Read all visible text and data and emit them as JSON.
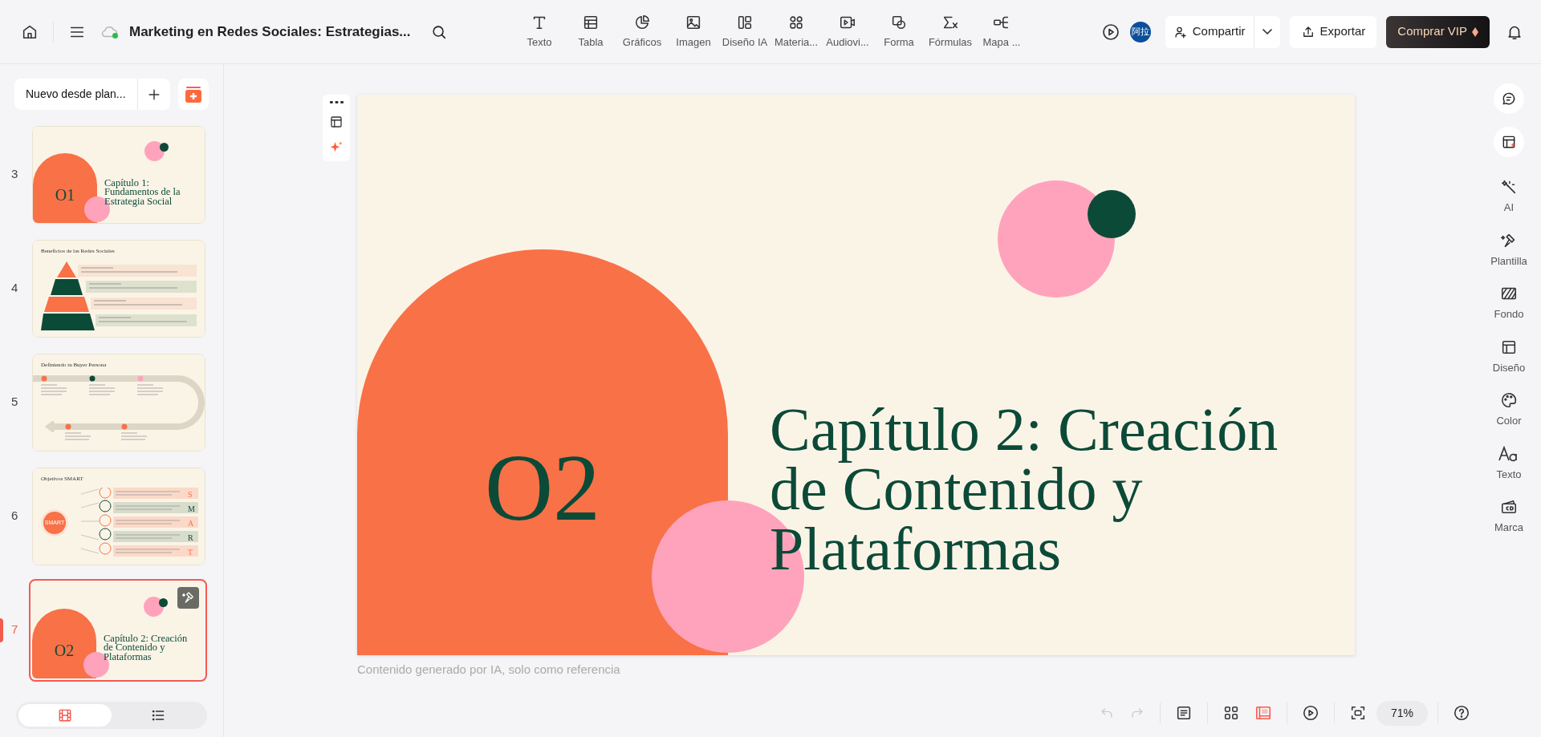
{
  "toolbar": {
    "title": "Marketing en Redes Sociales: Estrategias...",
    "synced": true,
    "insert_tools": [
      {
        "label": "Texto"
      },
      {
        "label": "Tabla"
      },
      {
        "label": "Gráficos"
      },
      {
        "label": "Imagen"
      },
      {
        "label": "Diseño IA"
      },
      {
        "label": "Materia..."
      },
      {
        "label": "Audiovi..."
      },
      {
        "label": "Forma"
      },
      {
        "label": "Fórmulas"
      },
      {
        "label": "Mapa ..."
      }
    ],
    "avatar": "阿拉",
    "share": "Compartir",
    "export": "Exportar",
    "vip": "Comprar VIP"
  },
  "sidebar": {
    "new_button": "Nuevo desde plan...",
    "slides": [
      {
        "number": "3",
        "kind": "section",
        "selected": false,
        "badge": "O1",
        "title": "Capítulo 1: Fundamentos de la Estrategia Social"
      },
      {
        "number": "4",
        "kind": "pyramid",
        "selected": false,
        "title": "Beneficios de las Redes Sociales"
      },
      {
        "number": "5",
        "kind": "path",
        "selected": false,
        "title": "Definiendo tu Buyer Persona"
      },
      {
        "number": "6",
        "kind": "smart",
        "selected": false,
        "title": "Objetivos SMART",
        "badge": "SMART",
        "letters": [
          "S",
          "M",
          "A",
          "R",
          "T"
        ]
      },
      {
        "number": "7",
        "kind": "section",
        "selected": true,
        "badge": "O2",
        "title": "Capítulo 2: Creación de Contenido y Plataformas"
      }
    ],
    "view_tabs": [
      {
        "kind": "filmstrip",
        "selected": true
      },
      {
        "kind": "outline",
        "selected": false
      }
    ]
  },
  "slide": {
    "badge": "O2",
    "title": "Capítulo 2: Creación de Contenido y Plataformas"
  },
  "caption": "Contenido generado por IA, solo como referencia",
  "right_panel": [
    {
      "label": "AI"
    },
    {
      "label": "Plantilla"
    },
    {
      "label": "Fondo"
    },
    {
      "label": "Diseño"
    },
    {
      "label": "Color"
    },
    {
      "label": "Texto"
    },
    {
      "label": "Marca"
    }
  ],
  "bottom_bar": {
    "undo_disabled": true,
    "redo_disabled": true,
    "views": [
      {
        "kind": "grid",
        "selected": false
      },
      {
        "kind": "editor",
        "selected": true
      }
    ],
    "zoom": "71%"
  }
}
